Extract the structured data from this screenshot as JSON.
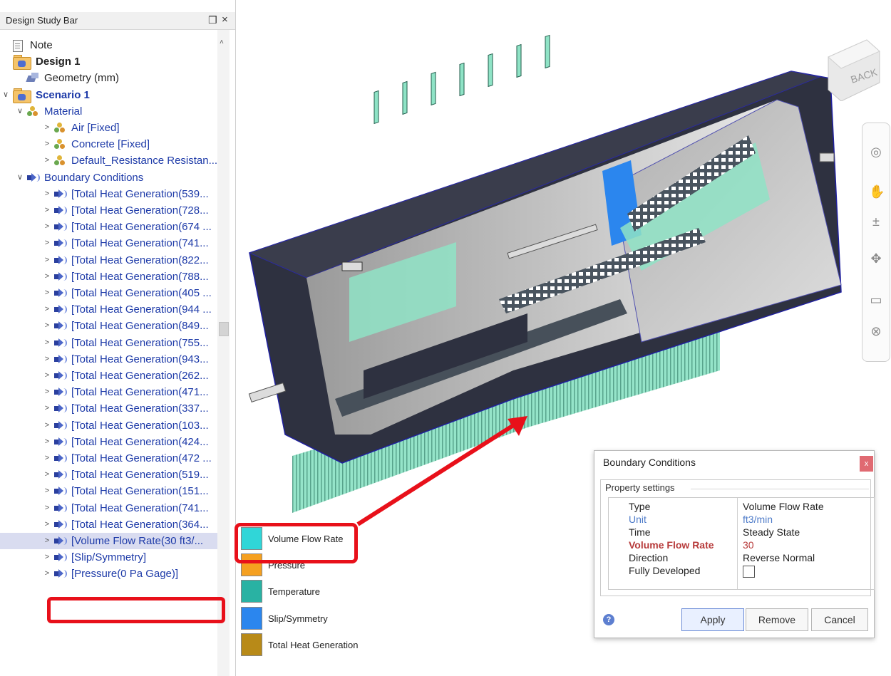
{
  "panel": {
    "title": "Design Study Bar",
    "pin_icon": "❒",
    "close_icon": "×",
    "scroll_up": "˄"
  },
  "tree": [
    {
      "label": "Note",
      "icon": "note-icon",
      "indent": 0,
      "chevron": "",
      "style": "dark"
    },
    {
      "label": "Design 1",
      "icon": "folder-icon",
      "indent": 0,
      "chevron": "",
      "style": "dark bold"
    },
    {
      "label": "Geometry (mm)",
      "icon": "geometry-icon",
      "indent": 1,
      "chevron": "",
      "style": "dark"
    },
    {
      "label": "Scenario 1",
      "icon": "folder-icon",
      "indent": 0,
      "chevron": "∨",
      "style": "blue bold"
    },
    {
      "label": "Material",
      "icon": "material-icon",
      "indent": 1,
      "chevron": "∨",
      "style": "blue"
    },
    {
      "label": "Air [Fixed]",
      "icon": "material-icon",
      "indent": 2,
      "chevron": ">",
      "style": "blue"
    },
    {
      "label": "Concrete [Fixed]",
      "icon": "material-icon",
      "indent": 2,
      "chevron": ">",
      "style": "blue"
    },
    {
      "label": "Default_Resistance Resistan...",
      "icon": "material-icon",
      "indent": 2,
      "chevron": ">",
      "style": "blue"
    },
    {
      "label": "Boundary Conditions",
      "icon": "boundary-icon",
      "indent": 1,
      "chevron": "∨",
      "style": "blue"
    },
    {
      "label": "[Total Heat Generation(539...",
      "icon": "boundary-icon",
      "indent": 2,
      "chevron": ">",
      "style": "blue"
    },
    {
      "label": "[Total Heat Generation(728...",
      "icon": "boundary-icon",
      "indent": 2,
      "chevron": ">",
      "style": "blue"
    },
    {
      "label": "[Total Heat Generation(674 ...",
      "icon": "boundary-icon",
      "indent": 2,
      "chevron": ">",
      "style": "blue"
    },
    {
      "label": "[Total Heat Generation(741...",
      "icon": "boundary-icon",
      "indent": 2,
      "chevron": ">",
      "style": "blue"
    },
    {
      "label": "[Total Heat Generation(822...",
      "icon": "boundary-icon",
      "indent": 2,
      "chevron": ">",
      "style": "blue"
    },
    {
      "label": "[Total Heat Generation(788...",
      "icon": "boundary-icon",
      "indent": 2,
      "chevron": ">",
      "style": "blue"
    },
    {
      "label": "[Total Heat Generation(405 ...",
      "icon": "boundary-icon",
      "indent": 2,
      "chevron": ">",
      "style": "blue"
    },
    {
      "label": "[Total Heat Generation(944 ...",
      "icon": "boundary-icon",
      "indent": 2,
      "chevron": ">",
      "style": "blue"
    },
    {
      "label": "[Total Heat Generation(849...",
      "icon": "boundary-icon",
      "indent": 2,
      "chevron": ">",
      "style": "blue"
    },
    {
      "label": "[Total Heat Generation(755...",
      "icon": "boundary-icon",
      "indent": 2,
      "chevron": ">",
      "style": "blue"
    },
    {
      "label": "[Total Heat Generation(943...",
      "icon": "boundary-icon",
      "indent": 2,
      "chevron": ">",
      "style": "blue"
    },
    {
      "label": "[Total Heat Generation(262...",
      "icon": "boundary-icon",
      "indent": 2,
      "chevron": ">",
      "style": "blue"
    },
    {
      "label": "[Total Heat Generation(471...",
      "icon": "boundary-icon",
      "indent": 2,
      "chevron": ">",
      "style": "blue"
    },
    {
      "label": "[Total Heat Generation(337...",
      "icon": "boundary-icon",
      "indent": 2,
      "chevron": ">",
      "style": "blue"
    },
    {
      "label": "[Total Heat Generation(103...",
      "icon": "boundary-icon",
      "indent": 2,
      "chevron": ">",
      "style": "blue"
    },
    {
      "label": "[Total Heat Generation(424...",
      "icon": "boundary-icon",
      "indent": 2,
      "chevron": ">",
      "style": "blue"
    },
    {
      "label": "[Total Heat Generation(472 ...",
      "icon": "boundary-icon",
      "indent": 2,
      "chevron": ">",
      "style": "blue"
    },
    {
      "label": "[Total Heat Generation(519...",
      "icon": "boundary-icon",
      "indent": 2,
      "chevron": ">",
      "style": "blue"
    },
    {
      "label": "[Total Heat Generation(151...",
      "icon": "boundary-icon",
      "indent": 2,
      "chevron": ">",
      "style": "blue"
    },
    {
      "label": "[Total Heat Generation(741...",
      "icon": "boundary-icon",
      "indent": 2,
      "chevron": ">",
      "style": "blue"
    },
    {
      "label": "[Total Heat Generation(364...",
      "icon": "boundary-icon",
      "indent": 2,
      "chevron": ">",
      "style": "blue"
    },
    {
      "label": "[Volume Flow Rate(30 ft3/...",
      "icon": "boundary-icon",
      "indent": 2,
      "chevron": ">",
      "style": "blue",
      "selected": true
    },
    {
      "label": "[Slip/Symmetry]",
      "icon": "boundary-icon",
      "indent": 2,
      "chevron": ">",
      "style": "blue"
    },
    {
      "label": "[Pressure(0 Pa Gage)]",
      "icon": "boundary-icon",
      "indent": 2,
      "chevron": ">",
      "style": "blue"
    }
  ],
  "legend": [
    {
      "label": "Volume Flow Rate",
      "color": "#30d6d8"
    },
    {
      "label": "Pressure",
      "color": "#f5a020"
    },
    {
      "label": "Temperature",
      "color": "#29b2a3"
    },
    {
      "label": "Slip/Symmetry",
      "color": "#2b86ee"
    },
    {
      "label": "Total Heat Generation",
      "color": "#b88a18"
    }
  ],
  "dialog": {
    "title": "Boundary Conditions",
    "close": "x",
    "section": "Property settings",
    "rows": [
      {
        "key": "Type",
        "value": "Volume Flow Rate",
        "style": ""
      },
      {
        "key": "Unit",
        "value": "ft3/min",
        "style": "blue"
      },
      {
        "key": "Time",
        "value": "Steady State",
        "style": ""
      },
      {
        "key": "Volume Flow Rate",
        "value": "30",
        "style": "red"
      },
      {
        "key": "Direction",
        "value": "Reverse Normal",
        "style": ""
      },
      {
        "key": "Fully Developed",
        "value": "",
        "style": "checkbox"
      }
    ],
    "help": "?",
    "apply": "Apply",
    "remove": "Remove",
    "cancel": "Cancel"
  },
  "viewcube": {
    "label": "BACK"
  },
  "colors": {
    "accent_red": "#e8101a",
    "model_dark": "#2e3140",
    "model_light": "#c8c8c8",
    "flow_arrows": "#8fe3c6",
    "slip_face": "#2b86ee"
  }
}
